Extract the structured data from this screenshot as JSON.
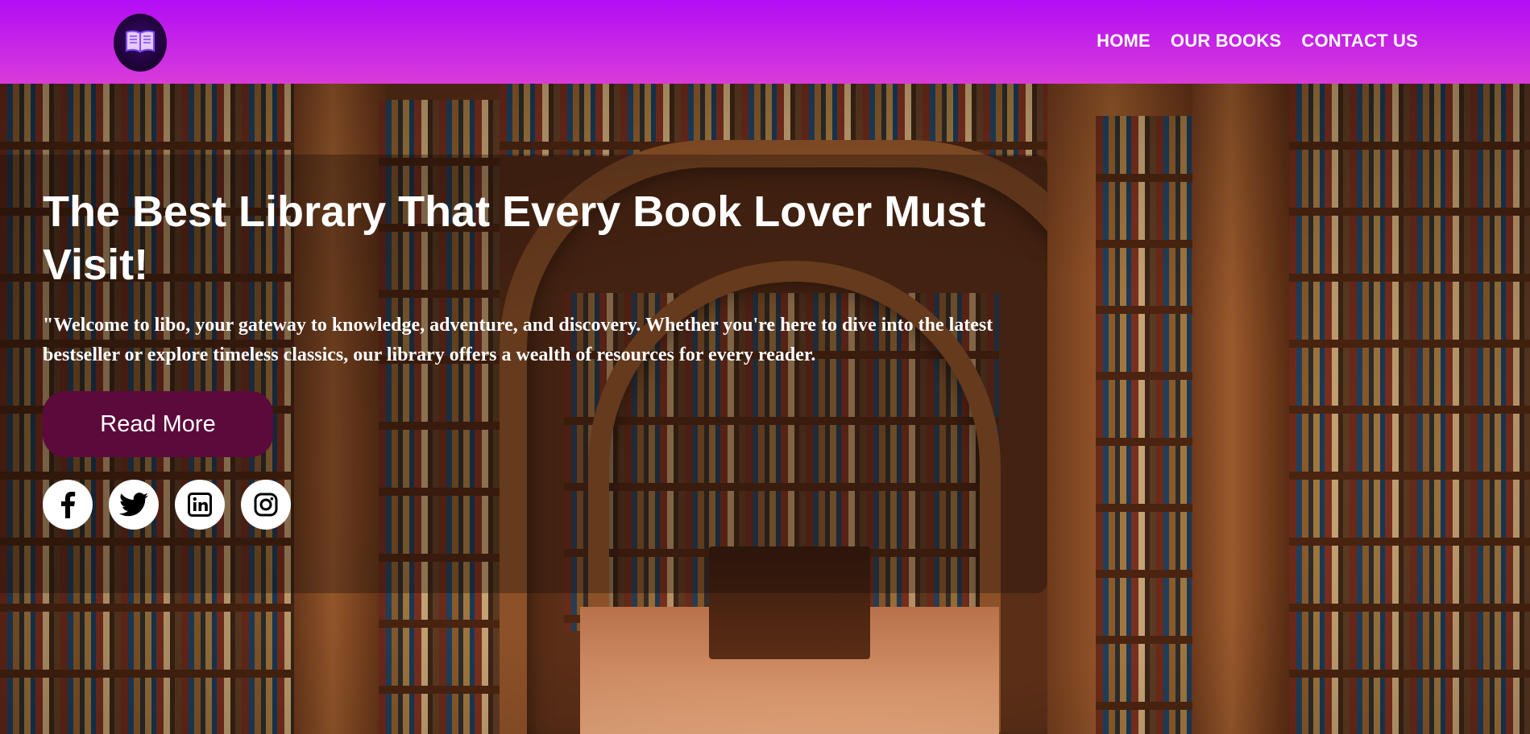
{
  "nav": {
    "logo_icon": "open-book-icon",
    "links": [
      "HOME",
      "OUR BOOKS",
      "CONTACT US"
    ]
  },
  "hero": {
    "title": "The Best Library That Every Book Lover Must Visit!",
    "text": "\"Welcome to libo, your gateway to knowledge, adventure, and discovery. Whether you're here to dive into the latest bestseller or explore timeless classics, our library offers a wealth of resources for every reader.",
    "button_label": "Read More",
    "socials": [
      "facebook-icon",
      "twitter-icon",
      "linkedin-icon",
      "instagram-icon"
    ]
  },
  "colors": {
    "nav_gradient_top": "#b30df5",
    "nav_gradient_bottom": "#d93bd9",
    "button_bg": "#5c0a3c",
    "text": "#ffffff"
  }
}
